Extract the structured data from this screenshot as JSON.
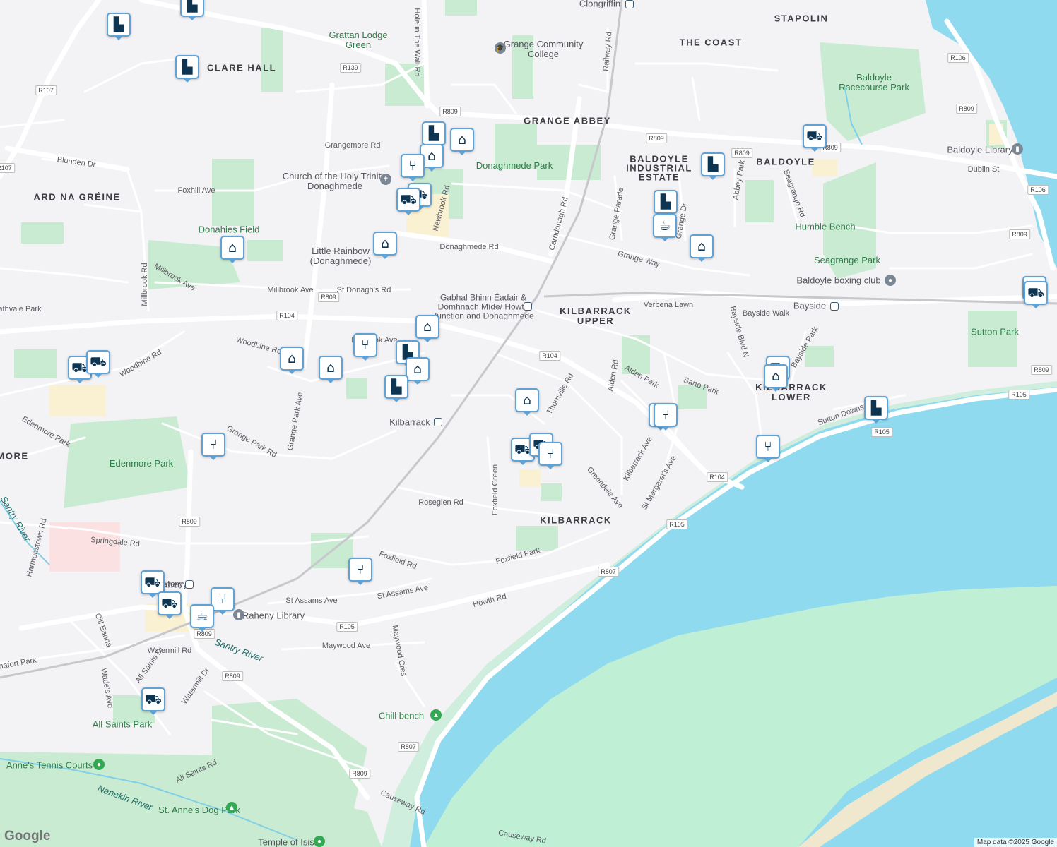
{
  "map": {
    "colors": {
      "land": "#f3f2f5",
      "water": "#8fdaee",
      "park": "#c9ebd2",
      "marsh": "#bff0d6",
      "road": "#ffffff",
      "rail": "#c7c7cc",
      "pin_border": "#5fa2d6",
      "pin_icon": "#0d3552"
    },
    "attribution": "Map data ©2025 Google",
    "logo": "Google",
    "area_labels": [
      {
        "key": "clare-hall",
        "text": "CLARE HALL"
      },
      {
        "key": "ard-na-greine",
        "text": "ARD NA GRÉINE"
      },
      {
        "key": "grange-abbey",
        "text": "GRANGE ABBEY"
      },
      {
        "key": "the-coast",
        "text": "THE COAST"
      },
      {
        "key": "stapolin",
        "text": "STAPOLIN"
      },
      {
        "key": "baldoyle",
        "text": "BALDOYLE"
      },
      {
        "key": "baldoyle-industrial",
        "text": "BALDOYLE INDUSTRIAL ESTATE"
      },
      {
        "key": "kilbarrack-upper",
        "text": "KILBARRACK UPPER"
      },
      {
        "key": "kilbarrack-lower",
        "text": "KILBARRACK LOWER"
      },
      {
        "key": "kilbarrack",
        "text": "KILBARRACK"
      },
      {
        "key": "edenmore",
        "text": "MORE"
      }
    ],
    "park_labels": [
      {
        "key": "grattan",
        "text": "Grattan Lodge Green"
      },
      {
        "key": "donaghmede-park",
        "text": "Donaghmede Park"
      },
      {
        "key": "donahies",
        "text": "Donahies Field"
      },
      {
        "key": "baldoyle-racecourse",
        "text": "Baldoyle Racecourse Park"
      },
      {
        "key": "humble-bench",
        "text": "Humble Bench"
      },
      {
        "key": "seagrange",
        "text": "Seagrange Park"
      },
      {
        "key": "sutton-park",
        "text": "Sutton Park"
      },
      {
        "key": "edenmore-park",
        "text": "Edenmore Park"
      },
      {
        "key": "all-saints-park",
        "text": "All Saints Park"
      },
      {
        "key": "chill-bench",
        "text": "Chill bench"
      },
      {
        "key": "st-annes-tennis",
        "text": "Anne's Tennis Courts"
      },
      {
        "key": "st-annes-dog",
        "text": "St. Anne's Dog Park"
      }
    ],
    "poi_labels": [
      {
        "key": "clongriffin",
        "text": "Clongriffin"
      },
      {
        "key": "grange-college",
        "text": "Grange Community College"
      },
      {
        "key": "church",
        "text": "Church of the Holy Trinity, Donaghmede"
      },
      {
        "key": "little-rainbow",
        "text": "Little Rainbow (Donaghmede)"
      },
      {
        "key": "howth-junction",
        "text": "Gabhal Bhinn Éadair & Domhnach Míde/ Howth Junction and Donaghmede"
      },
      {
        "key": "kilbarrack-station",
        "text": "Kilbarrack"
      },
      {
        "key": "bayside",
        "text": "Bayside"
      },
      {
        "key": "baldoyle-library",
        "text": "Baldoyle Library"
      },
      {
        "key": "baldoyle-boxing",
        "text": "Baldoyle boxing club"
      },
      {
        "key": "raheny-library",
        "text": "Raheny Library"
      },
      {
        "key": "raheny",
        "text": "Raheny"
      },
      {
        "key": "temple-of-isis",
        "text": "Temple of Isis"
      }
    ],
    "water_labels": [
      {
        "key": "santry-river",
        "text": "Santry River"
      },
      {
        "key": "santry-river-2",
        "text": "Santry River"
      },
      {
        "key": "nanekin",
        "text": "Nanekin River"
      }
    ],
    "road_labels": [
      {
        "key": "r1",
        "text": "Hole in The Wall Rd"
      },
      {
        "key": "r2",
        "text": "Grangemore Rd"
      },
      {
        "key": "r3",
        "text": "Blunden Dr"
      },
      {
        "key": "r4",
        "text": "Foxhill Ave"
      },
      {
        "key": "r5",
        "text": "Newbrook Rd"
      },
      {
        "key": "r6",
        "text": "Donaghmede Rd"
      },
      {
        "key": "r7",
        "text": "Millbrook Rd"
      },
      {
        "key": "r8",
        "text": "Millbrook Ave"
      },
      {
        "key": "r9",
        "text": "St Donagh's Rd"
      },
      {
        "key": "r10",
        "text": "Millbrook Ave"
      },
      {
        "key": "r11",
        "text": "Carndonagh Rd"
      },
      {
        "key": "r12",
        "text": "Railway Rd"
      },
      {
        "key": "r13",
        "text": "Grange Parade"
      },
      {
        "key": "r14",
        "text": "Grange Way"
      },
      {
        "key": "r15",
        "text": "Grange Dr"
      },
      {
        "key": "r16",
        "text": "Abbey Park"
      },
      {
        "key": "r17",
        "text": "Seagrange Rd"
      },
      {
        "key": "r18",
        "text": "Dublin St"
      },
      {
        "key": "r19",
        "text": "Verbena Lawn"
      },
      {
        "key": "r20",
        "text": "Bayside Walk"
      },
      {
        "key": "r21",
        "text": "Bayside Blvd N"
      },
      {
        "key": "r22",
        "text": "Bayside Park"
      },
      {
        "key": "r23",
        "text": "Alden Rd"
      },
      {
        "key": "r24",
        "text": "Alden Park"
      },
      {
        "key": "r25",
        "text": "Sarto Park"
      },
      {
        "key": "r26",
        "text": "Sutton Downs"
      },
      {
        "key": "r27",
        "text": "Thornville Rd"
      },
      {
        "key": "r28",
        "text": "Kilbarrack Ave"
      },
      {
        "key": "r29",
        "text": "St Margaret's Ave"
      },
      {
        "key": "r30",
        "text": "Greendale Ave"
      },
      {
        "key": "r31",
        "text": "Foxfield Green"
      },
      {
        "key": "r32",
        "text": "Roseglen Rd"
      },
      {
        "key": "r33",
        "text": "Foxfield Rd"
      },
      {
        "key": "r34",
        "text": "Foxfield Park"
      },
      {
        "key": "r35",
        "text": "Howth Rd"
      },
      {
        "key": "r36",
        "text": "St Assams Ave"
      },
      {
        "key": "r37",
        "text": "St Assams Ave"
      },
      {
        "key": "r38",
        "text": "Maywood Ave"
      },
      {
        "key": "r39",
        "text": "Maywood Cres"
      },
      {
        "key": "r40",
        "text": "Watermill Rd"
      },
      {
        "key": "r41",
        "text": "Watermill Dr"
      },
      {
        "key": "r42",
        "text": "All Saints Dr"
      },
      {
        "key": "r43",
        "text": "All Saints Rd"
      },
      {
        "key": "r44",
        "text": "Wade's Ave"
      },
      {
        "key": "r45",
        "text": "Cill Eanna"
      },
      {
        "key": "r46",
        "text": "Springdale Rd"
      },
      {
        "key": "r47",
        "text": "Harmonstown Rd"
      },
      {
        "key": "r48",
        "text": "Edenmore Park"
      },
      {
        "key": "r49",
        "text": "Woodbine Rd"
      },
      {
        "key": "r50",
        "text": "Woodbine Rd"
      },
      {
        "key": "r51",
        "text": "Grange Park Ave"
      },
      {
        "key": "r52",
        "text": "Grange Park Rd"
      },
      {
        "key": "r53",
        "text": "Causeway Rd"
      },
      {
        "key": "r54",
        "text": "Causeway Rd"
      },
      {
        "key": "r55",
        "text": "Raheny"
      },
      {
        "key": "r56",
        "text": "athvale Park"
      },
      {
        "key": "r57",
        "text": "nafort Park"
      },
      {
        "key": "r58",
        "text": "Millbrook Ave"
      }
    ],
    "shields": [
      "R139",
      "R107",
      "R107",
      "R809",
      "R809",
      "R809",
      "R809",
      "R106",
      "R106",
      "R809",
      "R809",
      "R104",
      "R809",
      "R104",
      "R104",
      "R105",
      "R105",
      "R105",
      "R807",
      "R809",
      "R105",
      "R809",
      "R809",
      "R809",
      "R807",
      "R809"
    ],
    "pins": [
      {
        "key": "p1",
        "type": "shopping-bag-icon"
      },
      {
        "key": "p2",
        "type": "shopping-bag-icon"
      },
      {
        "key": "p3",
        "type": "shopping-bag-icon"
      },
      {
        "key": "p4",
        "type": "shopping-bag-icon"
      },
      {
        "key": "p5",
        "type": "school-icon"
      },
      {
        "key": "p6",
        "type": "school-icon"
      },
      {
        "key": "p7",
        "type": "restaurant-icon"
      },
      {
        "key": "p8",
        "type": "shopping-cart-icon"
      },
      {
        "key": "p9",
        "type": "shopping-cart-icon"
      },
      {
        "key": "p10",
        "type": "school-icon"
      },
      {
        "key": "p11",
        "type": "school-icon"
      },
      {
        "key": "p12",
        "type": "shopping-cart-icon"
      },
      {
        "key": "p13",
        "type": "shopping-bag-icon"
      },
      {
        "key": "p14",
        "type": "shopping-bag-icon"
      },
      {
        "key": "p15",
        "type": "coffee-icon"
      },
      {
        "key": "p16",
        "type": "school-icon"
      },
      {
        "key": "p17",
        "type": "shopping-cart-icon"
      },
      {
        "key": "p18",
        "type": "shopping-cart-icon"
      },
      {
        "key": "p19",
        "type": "school-icon"
      },
      {
        "key": "p20",
        "type": "restaurant-icon"
      },
      {
        "key": "p21",
        "type": "school-icon"
      },
      {
        "key": "p22",
        "type": "shopping-bag-icon"
      },
      {
        "key": "p23",
        "type": "school-icon"
      },
      {
        "key": "p24",
        "type": "school-icon"
      },
      {
        "key": "p25",
        "type": "shopping-bag-icon"
      },
      {
        "key": "p26",
        "type": "shopping-cart-icon"
      },
      {
        "key": "p27",
        "type": "shopping-cart-icon"
      },
      {
        "key": "p28",
        "type": "school-icon"
      },
      {
        "key": "p29",
        "type": "shopping-cart-icon"
      },
      {
        "key": "p30",
        "type": "restaurant-icon"
      },
      {
        "key": "p31",
        "type": "school-icon"
      },
      {
        "key": "p32",
        "type": "restaurant-icon"
      },
      {
        "key": "p33",
        "type": "restaurant-icon"
      },
      {
        "key": "p34",
        "type": "shopping-cart-icon"
      },
      {
        "key": "p35",
        "type": "shopping-cart-icon"
      },
      {
        "key": "p36",
        "type": "restaurant-icon"
      },
      {
        "key": "p37",
        "type": "shopping-bag-icon"
      },
      {
        "key": "p38",
        "type": "restaurant-icon"
      },
      {
        "key": "p39",
        "type": "shopping-cart-icon"
      },
      {
        "key": "p40",
        "type": "shopping-cart-icon"
      },
      {
        "key": "p41",
        "type": "restaurant-icon"
      },
      {
        "key": "p42",
        "type": "coffee-icon"
      },
      {
        "key": "p43",
        "type": "shopping-cart-icon"
      },
      {
        "key": "p44",
        "type": "restaurant-icon"
      }
    ]
  }
}
